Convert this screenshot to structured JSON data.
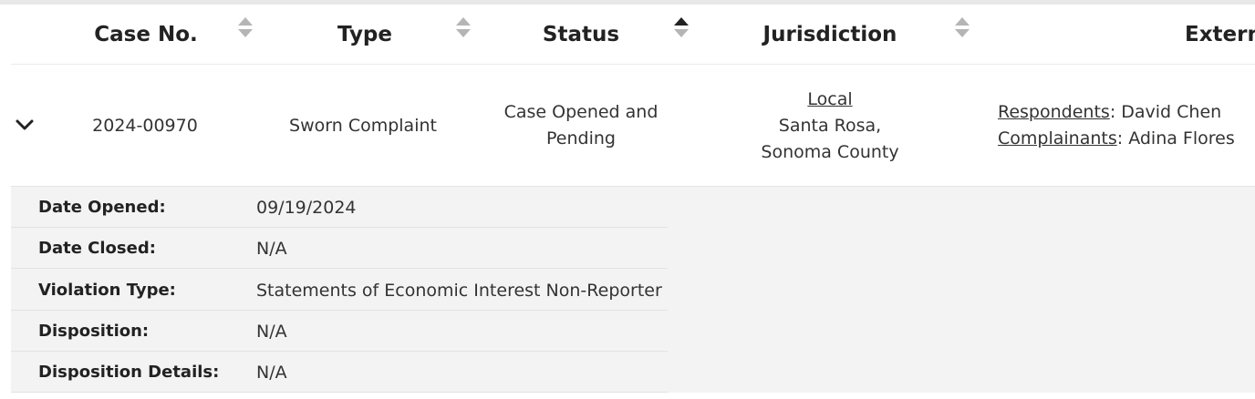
{
  "table": {
    "columns": [
      {
        "label": "Case No.",
        "sort": "none"
      },
      {
        "label": "Type",
        "sort": "none"
      },
      {
        "label": "Status",
        "sort": "ascending"
      },
      {
        "label": "Jurisdiction",
        "sort": "none"
      },
      {
        "label": "External",
        "sort": "none"
      }
    ]
  },
  "case": {
    "case_no": "2024-00970",
    "type": "Sworn Complaint",
    "status_line1": "Case Opened and",
    "status_line2": "Pending",
    "jurisdiction_level": "Local",
    "jurisdiction_line1": "Santa Rosa,",
    "jurisdiction_line2": "Sonoma County",
    "respondents_label": "Respondents",
    "respondents_value": ": David Chen",
    "complainants_label": "Complainants",
    "complainants_value": ": Adina Flores"
  },
  "details": [
    {
      "label": "Date Opened:",
      "value": "09/19/2024"
    },
    {
      "label": "Date Closed:",
      "value": "N/A"
    },
    {
      "label": "Violation Type:",
      "value": "Statements of Economic Interest Non-Reporter"
    },
    {
      "label": "Disposition:",
      "value": "N/A"
    },
    {
      "label": "Disposition Details:",
      "value": "N/A"
    }
  ],
  "colors": {
    "header_text": "#222222",
    "sort_inactive": "#b5b5b5",
    "sort_active": "#222222",
    "detail_background": "#f3f3f3"
  }
}
